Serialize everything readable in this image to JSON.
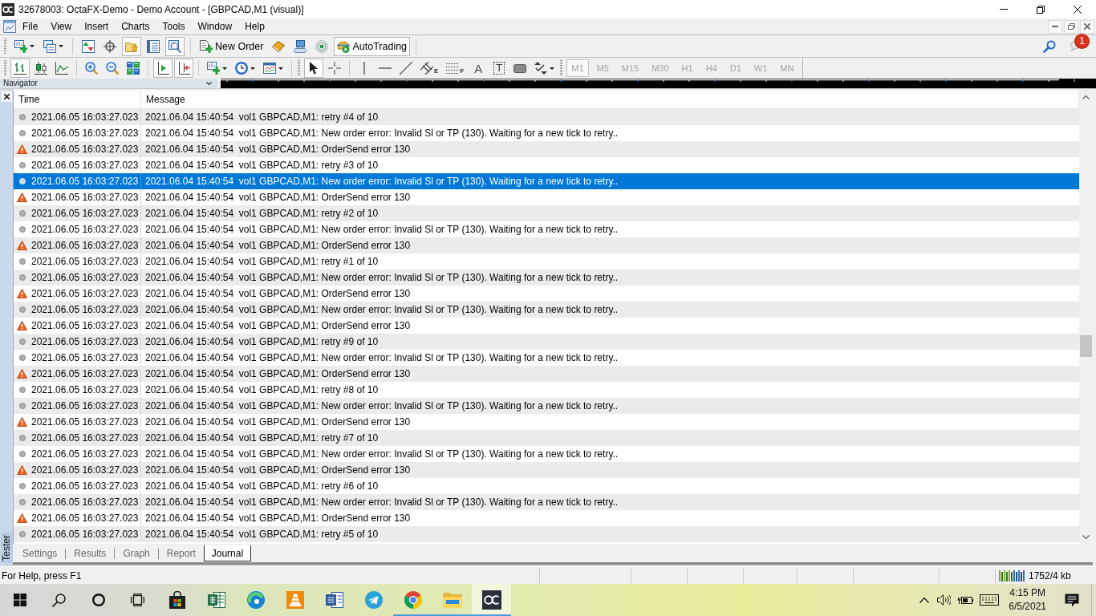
{
  "window": {
    "title": "32678003: OctaFX-Demo - Demo Account - [GBPCAD,M1 (visual)]"
  },
  "menu": [
    "File",
    "View",
    "Insert",
    "Charts",
    "Tools",
    "Window",
    "Help"
  ],
  "toolbar_standard": [
    {
      "pressed": false
    },
    {
      "pressed": false
    },
    {
      "pressed": false
    },
    {
      "pressed": false
    },
    {
      "pressed": true
    },
    {
      "pressed": false
    },
    {
      "pressed": true
    },
    {
      "label": "New Order",
      "pressed": false
    },
    {
      "pressed": false
    },
    {
      "pressed": false
    },
    {
      "pressed": false
    },
    {
      "label": "AutoTrading",
      "pressed": true
    }
  ],
  "notifications": {
    "count": "1"
  },
  "toolbar_charts": [
    {
      "pressed": true
    },
    {
      "pressed": false
    },
    {
      "pressed": false
    },
    {
      "pressed": false
    },
    {
      "pressed": false
    },
    {
      "pressed": false
    },
    {
      "pressed": true
    },
    {
      "pressed": true
    },
    {
      "pressed": false
    },
    {
      "pressed": false
    },
    {
      "pressed": false
    },
    {
      "pressed": true
    },
    {
      "pressed": false
    },
    {
      "pressed": false
    },
    {
      "pressed": false
    },
    {
      "pressed": false
    },
    {
      "label": "E",
      "pressed": false
    },
    {
      "label": "F",
      "pressed": false
    },
    {
      "label": "A",
      "pressed": false
    },
    {
      "label": "T",
      "pressed": false
    },
    {
      "pressed": false
    },
    {
      "pressed": false
    }
  ],
  "timeframes": [
    {
      "label": "M1",
      "selected": true,
      "disabled": true
    },
    {
      "label": "M5",
      "selected": false,
      "disabled": true
    },
    {
      "label": "M15",
      "selected": false,
      "disabled": true
    },
    {
      "label": "M30",
      "selected": false,
      "disabled": true
    },
    {
      "label": "H1",
      "selected": false,
      "disabled": true
    },
    {
      "label": "H4",
      "selected": false,
      "disabled": true
    },
    {
      "label": "D1",
      "selected": false,
      "disabled": true
    },
    {
      "label": "W1",
      "selected": false,
      "disabled": true
    },
    {
      "label": "MN",
      "selected": false,
      "disabled": true
    }
  ],
  "navigator": {
    "title": "Navigator"
  },
  "tester": {
    "title": "Tester",
    "columns": [
      "Time",
      "Message"
    ],
    "rows": [
      {
        "kind": "info",
        "time": "2021.06.05 16:03:27.023",
        "message": "2021.06.04 15:40:54  vol1 GBPCAD,M1: retry #4 of 10",
        "selected": false
      },
      {
        "kind": "info",
        "time": "2021.06.05 16:03:27.023",
        "message": "2021.06.04 15:40:54  vol1 GBPCAD,M1: New order error: Invalid Sl or TP (130). Waiting for a new tick to retry..",
        "selected": false
      },
      {
        "kind": "warning",
        "time": "2021.06.05 16:03:27.023",
        "message": "2021.06.04 15:40:54  vol1 GBPCAD,M1: OrderSend error 130",
        "selected": false
      },
      {
        "kind": "info",
        "time": "2021.06.05 16:03:27.023",
        "message": "2021.06.04 15:40:54  vol1 GBPCAD,M1: retry #3 of 10",
        "selected": false
      },
      {
        "kind": "info",
        "time": "2021.06.05 16:03:27.023",
        "message": "2021.06.04 15:40:54  vol1 GBPCAD,M1: New order error: Invalid Sl or TP (130). Waiting for a new tick to retry..",
        "selected": true
      },
      {
        "kind": "warning",
        "time": "2021.06.05 16:03:27.023",
        "message": "2021.06.04 15:40:54  vol1 GBPCAD,M1: OrderSend error 130",
        "selected": false
      },
      {
        "kind": "info",
        "time": "2021.06.05 16:03:27.023",
        "message": "2021.06.04 15:40:54  vol1 GBPCAD,M1: retry #2 of 10",
        "selected": false
      },
      {
        "kind": "info",
        "time": "2021.06.05 16:03:27.023",
        "message": "2021.06.04 15:40:54  vol1 GBPCAD,M1: New order error: Invalid Sl or TP (130). Waiting for a new tick to retry..",
        "selected": false
      },
      {
        "kind": "warning",
        "time": "2021.06.05 16:03:27.023",
        "message": "2021.06.04 15:40:54  vol1 GBPCAD,M1: OrderSend error 130",
        "selected": false
      },
      {
        "kind": "info",
        "time": "2021.06.05 16:03:27.023",
        "message": "2021.06.04 15:40:54  vol1 GBPCAD,M1: retry #1 of 10",
        "selected": false
      },
      {
        "kind": "info",
        "time": "2021.06.05 16:03:27.023",
        "message": "2021.06.04 15:40:54  vol1 GBPCAD,M1: New order error: Invalid Sl or TP (130). Waiting for a new tick to retry..",
        "selected": false
      },
      {
        "kind": "warning",
        "time": "2021.06.05 16:03:27.023",
        "message": "2021.06.04 15:40:54  vol1 GBPCAD,M1: OrderSend error 130",
        "selected": false
      },
      {
        "kind": "info",
        "time": "2021.06.05 16:03:27.023",
        "message": "2021.06.04 15:40:54  vol1 GBPCAD,M1: New order error: Invalid Sl or TP (130). Waiting for a new tick to retry..",
        "selected": false
      },
      {
        "kind": "warning",
        "time": "2021.06.05 16:03:27.023",
        "message": "2021.06.04 15:40:54  vol1 GBPCAD,M1: OrderSend error 130",
        "selected": false
      },
      {
        "kind": "info",
        "time": "2021.06.05 16:03:27.023",
        "message": "2021.06.04 15:40:54  vol1 GBPCAD,M1: retry #9 of 10",
        "selected": false
      },
      {
        "kind": "info",
        "time": "2021.06.05 16:03:27.023",
        "message": "2021.06.04 15:40:54  vol1 GBPCAD,M1: New order error: Invalid Sl or TP (130). Waiting for a new tick to retry..",
        "selected": false
      },
      {
        "kind": "warning",
        "time": "2021.06.05 16:03:27.023",
        "message": "2021.06.04 15:40:54  vol1 GBPCAD,M1: OrderSend error 130",
        "selected": false
      },
      {
        "kind": "info",
        "time": "2021.06.05 16:03:27.023",
        "message": "2021.06.04 15:40:54  vol1 GBPCAD,M1: retry #8 of 10",
        "selected": false
      },
      {
        "kind": "info",
        "time": "2021.06.05 16:03:27.023",
        "message": "2021.06.04 15:40:54  vol1 GBPCAD,M1: New order error: Invalid Sl or TP (130). Waiting for a new tick to retry..",
        "selected": false
      },
      {
        "kind": "warning",
        "time": "2021.06.05 16:03:27.023",
        "message": "2021.06.04 15:40:54  vol1 GBPCAD,M1: OrderSend error 130",
        "selected": false
      },
      {
        "kind": "info",
        "time": "2021.06.05 16:03:27.023",
        "message": "2021.06.04 15:40:54  vol1 GBPCAD,M1: retry #7 of 10",
        "selected": false
      },
      {
        "kind": "info",
        "time": "2021.06.05 16:03:27.023",
        "message": "2021.06.04 15:40:54  vol1 GBPCAD,M1: New order error: Invalid Sl or TP (130). Waiting for a new tick to retry..",
        "selected": false
      },
      {
        "kind": "warning",
        "time": "2021.06.05 16:03:27.023",
        "message": "2021.06.04 15:40:54  vol1 GBPCAD,M1: OrderSend error 130",
        "selected": false
      },
      {
        "kind": "info",
        "time": "2021.06.05 16:03:27.023",
        "message": "2021.06.04 15:40:54  vol1 GBPCAD,M1: retry #6 of 10",
        "selected": false
      },
      {
        "kind": "info",
        "time": "2021.06.05 16:03:27.023",
        "message": "2021.06.04 15:40:54  vol1 GBPCAD,M1: New order error: Invalid Sl or TP (130). Waiting for a new tick to retry..",
        "selected": false
      },
      {
        "kind": "warning",
        "time": "2021.06.05 16:03:27.023",
        "message": "2021.06.04 15:40:54  vol1 GBPCAD,M1: OrderSend error 130",
        "selected": false
      },
      {
        "kind": "info",
        "time": "2021.06.05 16:03:27.023",
        "message": "2021.06.04 15:40:54  vol1 GBPCAD,M1: retry #5 of 10",
        "selected": false
      }
    ],
    "tabs": [
      {
        "label": "Settings",
        "selected": false
      },
      {
        "label": "Results",
        "selected": false
      },
      {
        "label": "Graph",
        "selected": false
      },
      {
        "label": "Report",
        "selected": false
      },
      {
        "label": "Journal",
        "selected": true
      }
    ]
  },
  "status_bar": {
    "help": "For Help, press F1",
    "memory": "1752/4 kb"
  },
  "taskbar": {
    "apps": [
      {
        "running": false,
        "active": false
      },
      {
        "running": false,
        "active": false
      },
      {
        "running": false,
        "active": false
      },
      {
        "running": false,
        "active": false
      },
      {
        "running": false,
        "active": false
      },
      {
        "running": false,
        "active": false
      },
      {
        "running": true,
        "active": false
      },
      {
        "running": true,
        "active": false
      },
      {
        "running": true,
        "active": true
      }
    ],
    "clock": {
      "time": "4:15 PM",
      "date": "6/5/2021"
    }
  }
}
